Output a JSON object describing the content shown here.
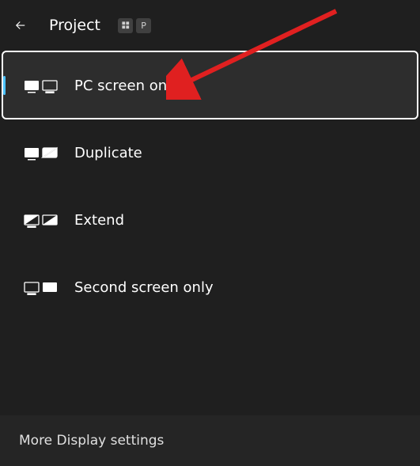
{
  "header": {
    "title": "Project",
    "shortcut_key": "P"
  },
  "options": [
    {
      "label": "PC screen only",
      "selected": true,
      "icon": "pc-screen-only-icon"
    },
    {
      "label": "Duplicate",
      "selected": false,
      "icon": "duplicate-icon"
    },
    {
      "label": "Extend",
      "selected": false,
      "icon": "extend-icon"
    },
    {
      "label": "Second screen only",
      "selected": false,
      "icon": "second-screen-only-icon"
    }
  ],
  "footer": {
    "link": "More Display settings"
  },
  "annotation": {
    "type": "arrow",
    "color": "#e02020"
  }
}
